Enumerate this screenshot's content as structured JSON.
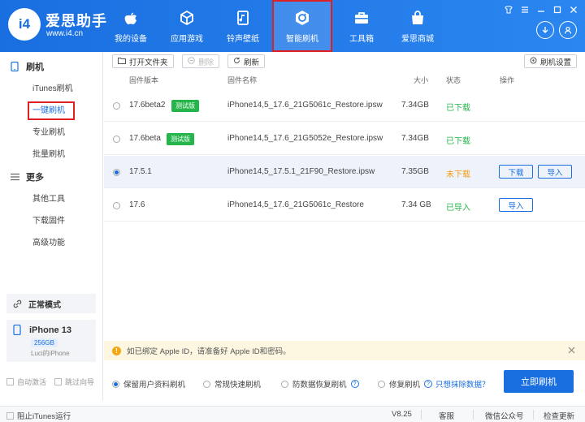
{
  "app": {
    "logo_text": "i4",
    "brand_name": "爱思助手",
    "brand_url": "www.i4.cn"
  },
  "nav": {
    "items": [
      {
        "label": "我的设备",
        "icon": "apple-icon"
      },
      {
        "label": "应用游戏",
        "icon": "cube-icon"
      },
      {
        "label": "铃声壁纸",
        "icon": "ringtone-icon"
      },
      {
        "label": "智能刷机",
        "icon": "flash-refresh-icon",
        "active": true
      },
      {
        "label": "工具箱",
        "icon": "toolbox-icon"
      },
      {
        "label": "爱思商城",
        "icon": "shopping-bag-icon"
      }
    ]
  },
  "sidebar": {
    "section_flash": "刷机",
    "flash_items": [
      "iTunes刷机",
      "一键刷机",
      "专业刷机",
      "批量刷机"
    ],
    "section_more": "更多",
    "more_items": [
      "其他工具",
      "下载固件",
      "高级功能"
    ],
    "mode": "正常模式",
    "device_name": "iPhone 13",
    "device_capacity": "256GB",
    "device_owner": "Luci的iPhone",
    "check_auto_activate": "自动激活",
    "check_skip_guide": "跳过向导"
  },
  "toolbar": {
    "open_folder": "打开文件夹",
    "delete": "删除",
    "refresh": "刷新",
    "flash_settings": "刷机设置"
  },
  "table": {
    "headers": {
      "version": "固件版本",
      "name": "固件名称",
      "size": "大小",
      "status": "状态",
      "action": "操作"
    },
    "rows": [
      {
        "version": "17.6beta2",
        "badge": "测试版",
        "name": "iPhone14,5_17.6_21G5061c_Restore.ipsw",
        "size": "7.34GB",
        "status": "已下载"
      },
      {
        "version": "17.6beta",
        "badge": "测试版",
        "name": "iPhone14,5_17.6_21G5052e_Restore.ipsw",
        "size": "7.34GB",
        "status": "已下载"
      },
      {
        "version": "17.5.1",
        "name": "iPhone14,5_17.5.1_21F90_Restore.ipsw",
        "size": "7.35GB",
        "status": "未下载",
        "btn_download": "下载",
        "btn_import": "导入"
      },
      {
        "version": "17.6",
        "name": "iPhone14,5_17.6_21G5061c_Restore",
        "size": "7.34 GB",
        "status": "已导入",
        "btn_import": "导入"
      }
    ]
  },
  "notice": {
    "text": "如已绑定 Apple ID，请准备好 Apple ID和密码。"
  },
  "options": {
    "keep_data": "保留用户资料刷机",
    "quick": "常规快速刷机",
    "anti_recovery": "防数据恢复刷机",
    "repair": "修复刷机",
    "erase_link": "只想抹除数据？",
    "flash_now": "立即刷机"
  },
  "statusbar": {
    "block_itunes": "阻止iTunes运行",
    "version": "V8.25",
    "service": "客服",
    "wechat": "微信公众号",
    "update": "检查更新"
  },
  "colors": {
    "accent": "#1a6fe0",
    "green": "#25b54a",
    "orange": "#f39c12",
    "highlight": "#e02020"
  }
}
